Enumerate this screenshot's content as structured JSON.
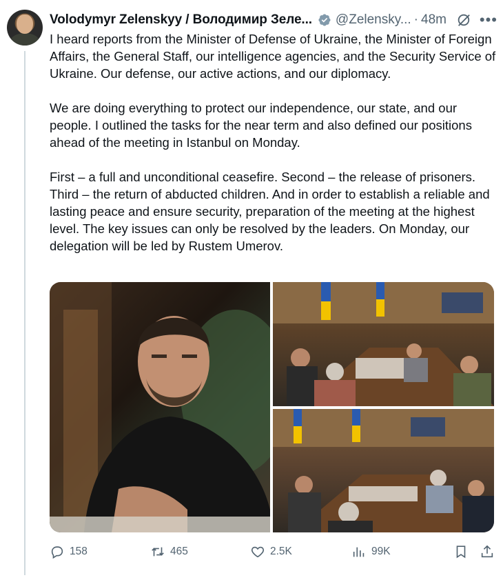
{
  "author": {
    "name": "Volodymyr Zelenskyy / Володимир Зеле...",
    "handle": "@Zelensky...",
    "separator": "·",
    "time": "48m"
  },
  "icons": {
    "verified": "verified-badge-icon",
    "grok": "grok-icon",
    "more": "more-icon"
  },
  "body": {
    "paragraphs": [
      "I heard reports from the Minister of Defense of Ukraine, the Minister of Foreign Affairs, the General Staff, our intelligence agencies, and the Security Service of Ukraine. Our defense, our active actions, and our diplomacy.",
      "We are doing everything to protect our independence, our state, and our people. I outlined the tasks for the near term and also defined our positions ahead of the meeting in Istanbul on Monday.",
      "First – a full and unconditional ceasefire. Second – the release of prisoners. Third – the return of abducted children. And in order to establish a reliable and lasting peace and ensure security, preparation of the meeting at the highest level. The key issues can only be resolved by the leaders. On Monday, our delegation will be led by Rustem Umerov."
    ]
  },
  "actions": {
    "replies": "158",
    "reposts": "465",
    "likes": "2.5K",
    "views": "99K"
  },
  "colors": {
    "text": "#0f1419",
    "secondary": "#536471",
    "verified": "#829aab",
    "thread_line": "#cfd9de"
  }
}
